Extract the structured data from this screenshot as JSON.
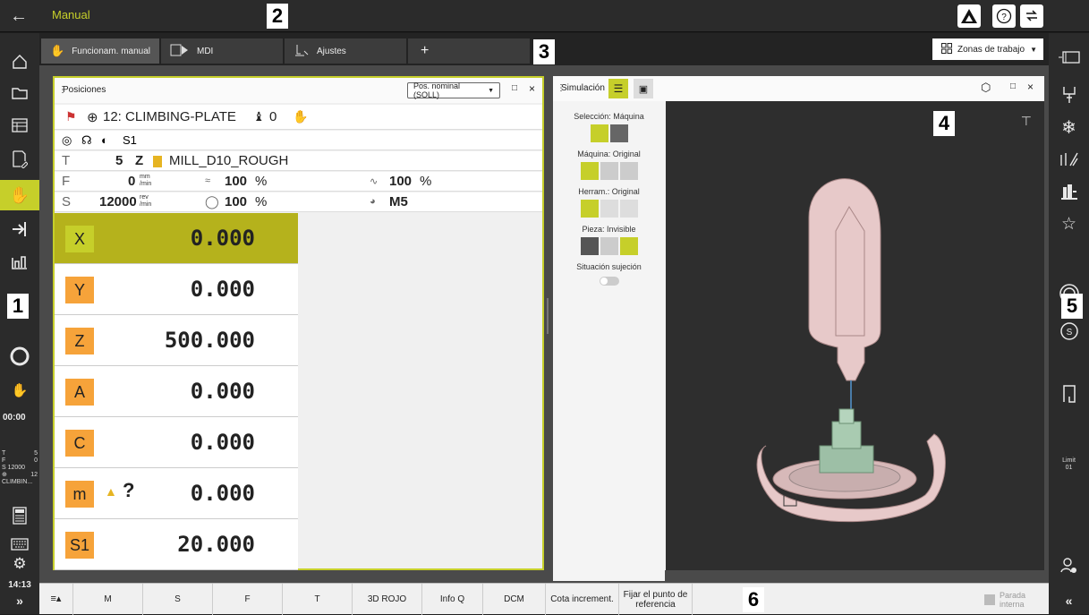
{
  "header": {
    "title": "Manual"
  },
  "tabs": [
    {
      "label": "Funcionam. manual"
    },
    {
      "label": "MDI"
    },
    {
      "label": "Ajustes"
    }
  ],
  "workspace_menu": {
    "label": "Zonas de trabajo"
  },
  "positions_panel": {
    "title": "Posiciones",
    "mode_select": "Pos. nominal (SOLL)",
    "datum_label": "12: CLIMBING-PLATE",
    "datum_count": "0",
    "spindle_label": "S1",
    "tool_row": {
      "label": "T",
      "number": "5",
      "axis": "Z",
      "name": "MILL_D10_ROUGH"
    },
    "feed_row": {
      "label": "F",
      "value": "0",
      "unit_top": "mm",
      "unit_bottom": "/min",
      "override1": "100",
      "override2": "100",
      "pct": "%"
    },
    "speed_row": {
      "label": "S",
      "value": "12000",
      "unit_top": "rev",
      "unit_bottom": "/min",
      "override": "100",
      "pct": "%",
      "mfunc": "M5"
    },
    "axes": [
      {
        "name": "X",
        "value": "0.000"
      },
      {
        "name": "Y",
        "value": "0.000"
      },
      {
        "name": "Z",
        "value": "500.000"
      },
      {
        "name": "A",
        "value": "0.000"
      },
      {
        "name": "C",
        "value": "0.000"
      },
      {
        "name": "m",
        "value": "0.000",
        "mark": "?"
      },
      {
        "name": "S1",
        "value": "20.000"
      }
    ]
  },
  "sim_panel": {
    "title": "Simulación",
    "selection": "Selección: Máquina",
    "machine": "Máquina: Original",
    "tool": "Herram.: Original",
    "workpiece": "Pieza: Invisible",
    "clamp": "Situación sujeción"
  },
  "left_status": {
    "time": "00:00",
    "t_label": "T",
    "t_val": "5",
    "f_label": "F",
    "f_val": "0",
    "s_val": "S 12000",
    "datum_num": "12",
    "datum_short": "CLIMBIN...",
    "clock": "14:13"
  },
  "right_status": {
    "limit": "Limit",
    "limit_num": "01"
  },
  "softkeys": [
    {
      "label": "M"
    },
    {
      "label": "S"
    },
    {
      "label": "F"
    },
    {
      "label": "T"
    },
    {
      "label": "3D ROJO"
    },
    {
      "label": "Info Q"
    },
    {
      "label": "DCM"
    },
    {
      "label": "Cota increment."
    },
    {
      "label": "Fijar el punto de referencia"
    }
  ],
  "stop": {
    "label": "Parada interna"
  },
  "callouts": [
    "1",
    "2",
    "3",
    "4",
    "5",
    "6"
  ],
  "colors": {
    "accent": "#c6cf2a",
    "axis": "#f6a33a",
    "model": "#e7c9c9"
  }
}
